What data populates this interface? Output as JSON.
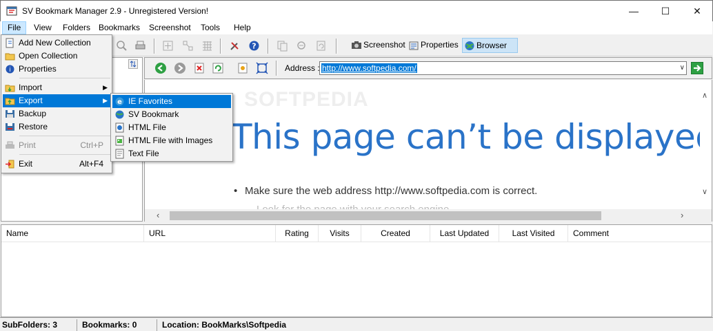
{
  "window": {
    "title": "SV Bookmark Manager 2.9 - Unregistered Version!",
    "minimize": "—",
    "maximize": "☐",
    "close": "✕"
  },
  "menubar": [
    "File",
    "View",
    "Folders",
    "Bookmarks",
    "Screenshot",
    "Tools",
    "Help"
  ],
  "toolbar": {
    "screenshot_label": "Screenshot",
    "properties_label": "Properties",
    "browser_label": "Browser"
  },
  "file_menu": {
    "items": [
      {
        "label": "Add New Collection",
        "icon": "new-collection-icon"
      },
      {
        "label": "Open Collection",
        "icon": "folder-open-icon"
      },
      {
        "label": "Properties",
        "icon": "properties-icon"
      },
      {
        "label": "Import",
        "icon": "import-icon",
        "submenu": true
      },
      {
        "label": "Export",
        "icon": "export-icon",
        "submenu": true,
        "highlighted": true
      },
      {
        "label": "Backup",
        "icon": "backup-icon"
      },
      {
        "label": "Restore",
        "icon": "restore-icon"
      },
      {
        "label": "Print",
        "icon": "print-icon",
        "shortcut": "Ctrl+P",
        "disabled": true
      },
      {
        "label": "Exit",
        "icon": "exit-icon",
        "shortcut": "Alt+F4"
      }
    ]
  },
  "export_menu": {
    "items": [
      {
        "label": "IE Favorites",
        "icon": "ie-icon",
        "highlighted": true
      },
      {
        "label": "SV Bookmark",
        "icon": "sv-bookmark-icon"
      },
      {
        "label": "HTML File",
        "icon": "html-file-icon"
      },
      {
        "label": "HTML File with Images",
        "icon": "html-images-icon"
      },
      {
        "label": "Text File",
        "icon": "text-file-icon"
      }
    ]
  },
  "address": {
    "label": "Address :",
    "value": "http://www.softpedia.com/"
  },
  "browser": {
    "watermark": "SOFTPEDIA",
    "error_title": "This page can’t be displayed",
    "bullet1": "Make sure the web address http://www.softpedia.com is correct.",
    "bullet2": "Look for the page with your search engine."
  },
  "list_columns": [
    "Name",
    "URL",
    "Rating",
    "Visits",
    "Created",
    "Last Updated",
    "Last Visited",
    "Comment"
  ],
  "statusbar": {
    "subfolders": "SubFolders: 3",
    "bookmarks": "Bookmarks: 0",
    "location": "Location: BookMarks\\Softpedia"
  },
  "colors": {
    "accent": "#0078d7",
    "error_title": "#2a73c8",
    "menu_highlight": "#0078d7"
  }
}
